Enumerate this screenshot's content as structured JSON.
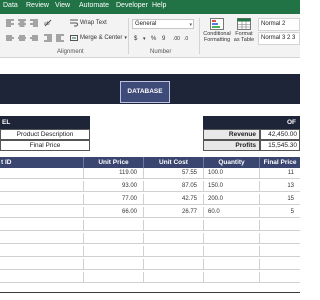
{
  "menu": {
    "items": [
      "Data",
      "Review",
      "View",
      "Automate",
      "Developer",
      "Help"
    ]
  },
  "ribbon": {
    "wrap_text": "Wrap Text",
    "merge_center": "Merge & Center",
    "alignment_label": "Alignment",
    "number_format": "General",
    "number_label": "Number",
    "currency_symbol": "$",
    "percent_symbol": "%",
    "comma_symbol": "9",
    "dec_inc": ".00",
    "dec_dec": ".0",
    "conditional_formatting": "Conditional Formatting",
    "format_as_table": "Format as Table",
    "style_1": "Normal 2",
    "style_2": "Normal 3 2 3"
  },
  "sheet": {
    "database_button": "DATABASE",
    "left_header_partial": "EL",
    "product_description": "Product Description",
    "final_price": "Final Price",
    "right_header_partial": "OF",
    "revenue_label": "Revenue",
    "revenue_value": "42,450.00",
    "profits_label": "Profits",
    "profits_value": "15,545.30"
  },
  "table": {
    "headers": [
      "t ID",
      "Unit Price",
      "Unit Cost",
      "Quantity",
      "Final Price"
    ],
    "rows": [
      [
        "",
        "119.00",
        "57.55",
        "100.0",
        "11"
      ],
      [
        "",
        "93.00",
        "87.05",
        "150.0",
        "13"
      ],
      [
        "",
        "77.00",
        "42.75",
        "200.0",
        "15"
      ],
      [
        "",
        "66.00",
        "26.77",
        "60.0",
        "5"
      ]
    ]
  },
  "colors": {
    "excel_green": "#217346",
    "banner": "#1f2538",
    "header": "#3a4670",
    "button": "#3e4a78"
  }
}
